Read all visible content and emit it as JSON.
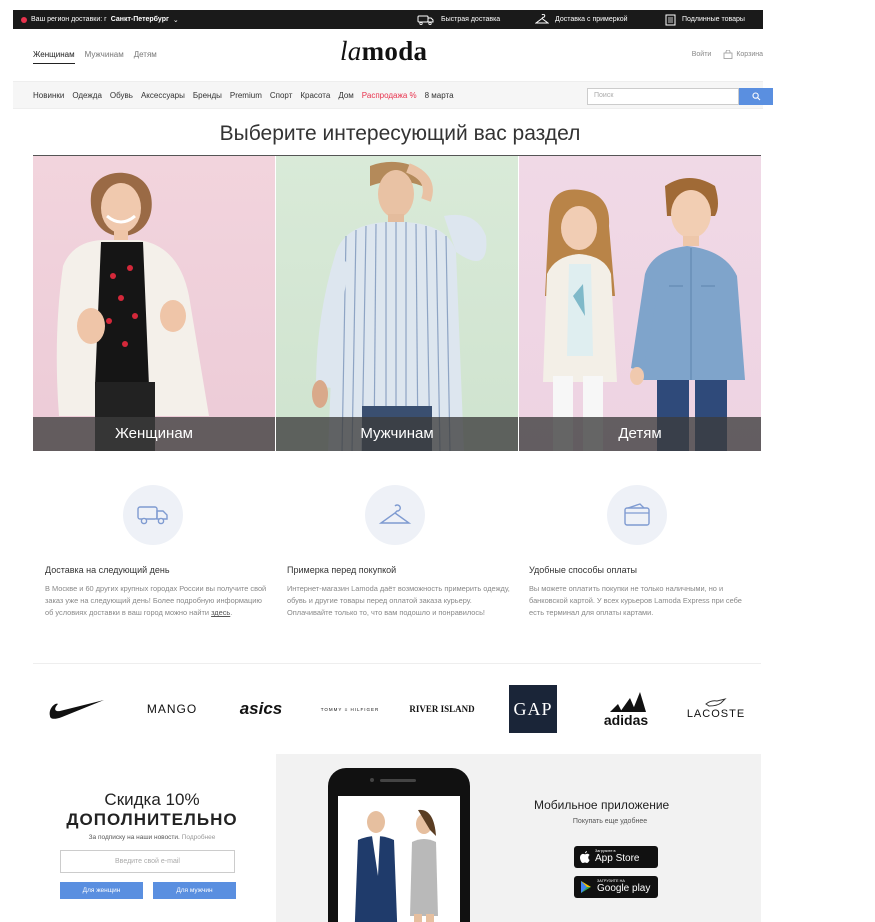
{
  "topbar": {
    "region_prefix": "Ваш регион доставки: г",
    "region_city": "Санкт-Петербург",
    "features": [
      "Быстрая доставка",
      "Доставка с примеркой",
      "Подлинные товары"
    ]
  },
  "header": {
    "gender_tabs": [
      "Женщинам",
      "Мужчинам",
      "Детям"
    ],
    "logo_la": "la",
    "logo_moda": "moda",
    "login": "Войти",
    "cart": "Корзина"
  },
  "categories": [
    "Новинки",
    "Одежда",
    "Обувь",
    "Аксессуары",
    "Бренды",
    "Premium",
    "Спорт",
    "Красота",
    "Дом",
    "Распродажа %",
    "8 марта"
  ],
  "search": {
    "placeholder": "Поиск"
  },
  "section_title": "Выберите интересующий вас раздел",
  "hero": {
    "women": "Женщинам",
    "men": "Мужчинам",
    "kids": "Детям"
  },
  "features": [
    {
      "title": "Доставка на следующий день",
      "text": "В Москве и 60 других крупных городах России вы получите свой заказ уже на следующий день! Более подробную информацию об условиях доставки в ваш город можно найти",
      "link": "здесь"
    },
    {
      "title": "Примерка перед покупкой",
      "text": "Интернет-магазин Lamoda даёт возможность примерить одежду, обувь и другие товары перед оплатой заказа курьеру. Оплачивайте только то, что вам подошло и понравилось!"
    },
    {
      "title": "Удобные способы оплаты",
      "text": "Вы можете оплатить покупки не только наличными, но и банковской картой. У всех курьеров Lamoda Express при себе есть терминал для оплаты картами."
    }
  ],
  "brands": {
    "mango": "MANGO",
    "asics": "asics",
    "tommy": "TOMMY ≡ HILFIGER",
    "river": "RIVER ISLAND",
    "gap": "GAP",
    "adidas": "adidas",
    "lacoste": "LACOSTE"
  },
  "promo": {
    "line1": "Скидка 10%",
    "line2": "ДОПОЛНИТЕЛЬНО",
    "sub": "За подписку на наши новости.",
    "more": "Подробнее",
    "email_placeholder": "Введите свой e-mail",
    "btn_women": "Для женщин",
    "btn_men": "Для мужчин"
  },
  "app": {
    "title": "Мобильное приложение",
    "tagline": "Покупать еще удобнее",
    "appstore_small": "Загрузите в",
    "appstore_big": "App Store",
    "google_small": "ЗАГРУЗИТЕ НА",
    "google_big": "Google play"
  },
  "colors": {
    "accent_blue": "#5a8fe0",
    "sale_red": "#e8324d",
    "topbar": "#1a1a1a"
  }
}
